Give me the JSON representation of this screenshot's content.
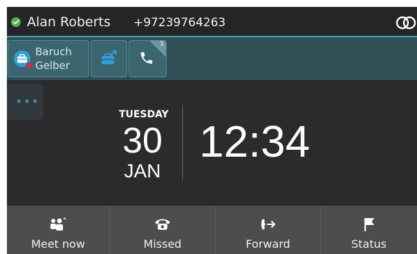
{
  "status_bar": {
    "presence_color": "#4caf50",
    "presence_icon": "check-icon",
    "user_name": "Alan Roberts",
    "phone_number": "+97239764263",
    "right_icon": "interlinked-rings-icon"
  },
  "line_keys": {
    "contact": {
      "name_line1": "Baruch",
      "name_line2": "Gelber",
      "icon": "briefcase-avatar-icon",
      "presence_color": "#e0283a"
    },
    "briefcase_key": {
      "icon": "briefcase-arrow-icon"
    },
    "phone_key": {
      "icon": "phone-icon",
      "badge": "1"
    }
  },
  "more_button": {
    "icon": "more-dots-icon",
    "dots": "•••"
  },
  "date": {
    "day_name": "TUESDAY",
    "day_number": "30",
    "month": "JAN"
  },
  "time": "12:34",
  "softkeys": [
    {
      "label": "Meet now",
      "icon": "meet-now-icon"
    },
    {
      "label": "Missed",
      "icon": "missed-call-icon"
    },
    {
      "label": "Forward",
      "icon": "forward-call-icon"
    },
    {
      "label": "Status",
      "icon": "flag-icon"
    }
  ],
  "colors": {
    "accent": "#4aa3b8",
    "background": "#2b2b2d",
    "line_key_bar": "#2f4f56",
    "softkey_bar": "#4d4d4f",
    "contact_avatar": "#2d9fd9"
  }
}
